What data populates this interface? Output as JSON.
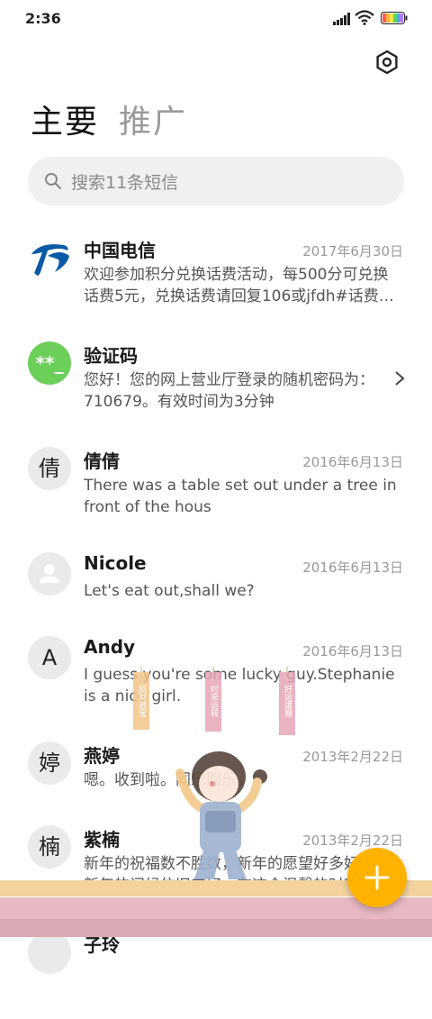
{
  "status": {
    "time": "2:36"
  },
  "tabs": {
    "main": "主要",
    "promo": "推广"
  },
  "search": {
    "placeholder": "搜索11条短信"
  },
  "messages": [
    {
      "name": "中国电信",
      "date": "2017年6月30日",
      "preview": "欢迎参加积分兑换话费活动，每500分可兑换话费5元，兑换话费请回复106或jfdh#话费…",
      "avatar": "telecom-logo"
    },
    {
      "name": "验证码",
      "date": "",
      "preview": "您好！您的网上营业厅登录的随机密码为：710679。有效时间为3分钟",
      "avatar_text": "**_"
    },
    {
      "name": "倩倩",
      "date": "2016年6月13日",
      "preview": "There was a table set out under a tree in front of the hous",
      "avatar_text": "倩"
    },
    {
      "name": "Nicole",
      "date": "2016年6月13日",
      "preview": "Let's eat out,shall we?",
      "avatar": "person-icon"
    },
    {
      "name": "Andy",
      "date": "2016年6月13日",
      "preview": "I guess you're some lucky guy.Stephanie is a nice girl.",
      "avatar_text": "A"
    },
    {
      "name": "燕婷",
      "date": "2013年2月22日",
      "preview": "嗯。收到啦。同乐同乐。",
      "avatar_text": "婷"
    },
    {
      "name": "紫楠",
      "date": "2013年2月22日",
      "preview": "新年的祝福数不胜数，新年的愿望好多好多，新年的问候依旧美好，在这个温馨的时刻",
      "avatar_text": "楠"
    },
    {
      "name": "子玲",
      "date": "",
      "preview": "",
      "avatar_text": ""
    }
  ],
  "banners": [
    "招财进宝",
    "时来运转",
    "好运爆棚"
  ],
  "colors": {
    "accent": "#ffb300",
    "verify_avatar": "#6ccf59",
    "telecom_blue": "#0a5aa8"
  }
}
